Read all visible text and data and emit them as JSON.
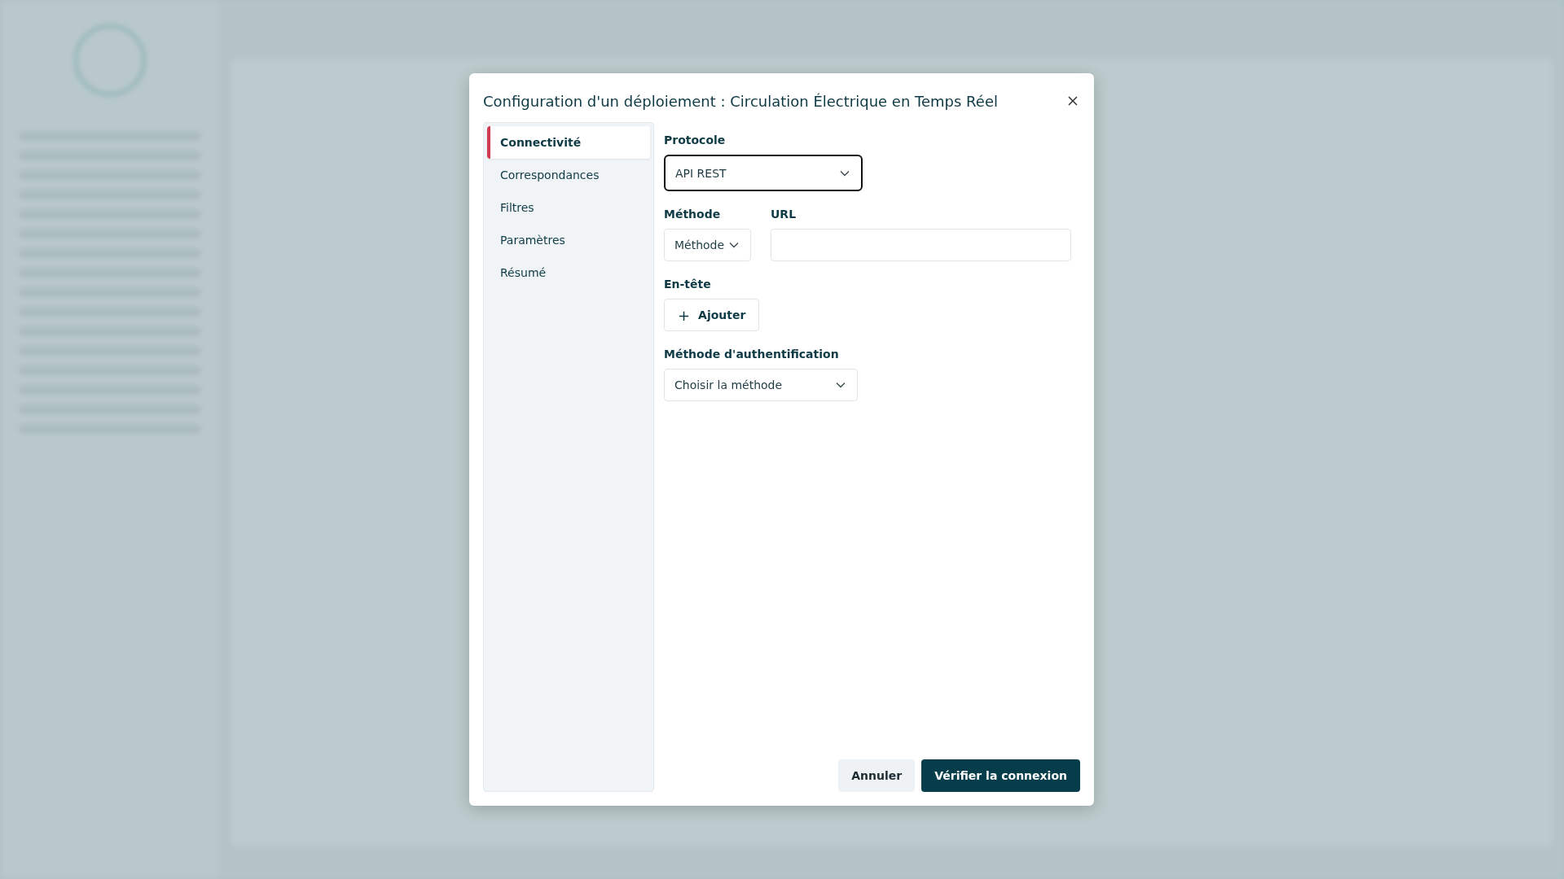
{
  "dialog": {
    "title": "Configuration d'un déploiement : Circulation Électrique en Temps Réel",
    "steps": [
      {
        "label": "Connectivité",
        "selected": true
      },
      {
        "label": "Correspondances",
        "selected": false
      },
      {
        "label": "Filtres",
        "selected": false
      },
      {
        "label": "Paramètres",
        "selected": false
      },
      {
        "label": "Résumé",
        "selected": false
      }
    ],
    "protocol": {
      "label": "Protocole",
      "value": "API REST",
      "focused": true
    },
    "method": {
      "label": "Méthode",
      "value": "Méthode"
    },
    "url": {
      "label": "URL"
    },
    "header": {
      "label": "En-tête",
      "button_icon": "+",
      "button": "Ajouter"
    },
    "auth": {
      "label": "Méthode d'authentification",
      "value": "Choisir la méthode"
    },
    "buttons": [
      {
        "label": "Annuler",
        "kind": "secondary"
      },
      {
        "label": "Vérifier la connexion",
        "kind": "primary"
      }
    ]
  }
}
